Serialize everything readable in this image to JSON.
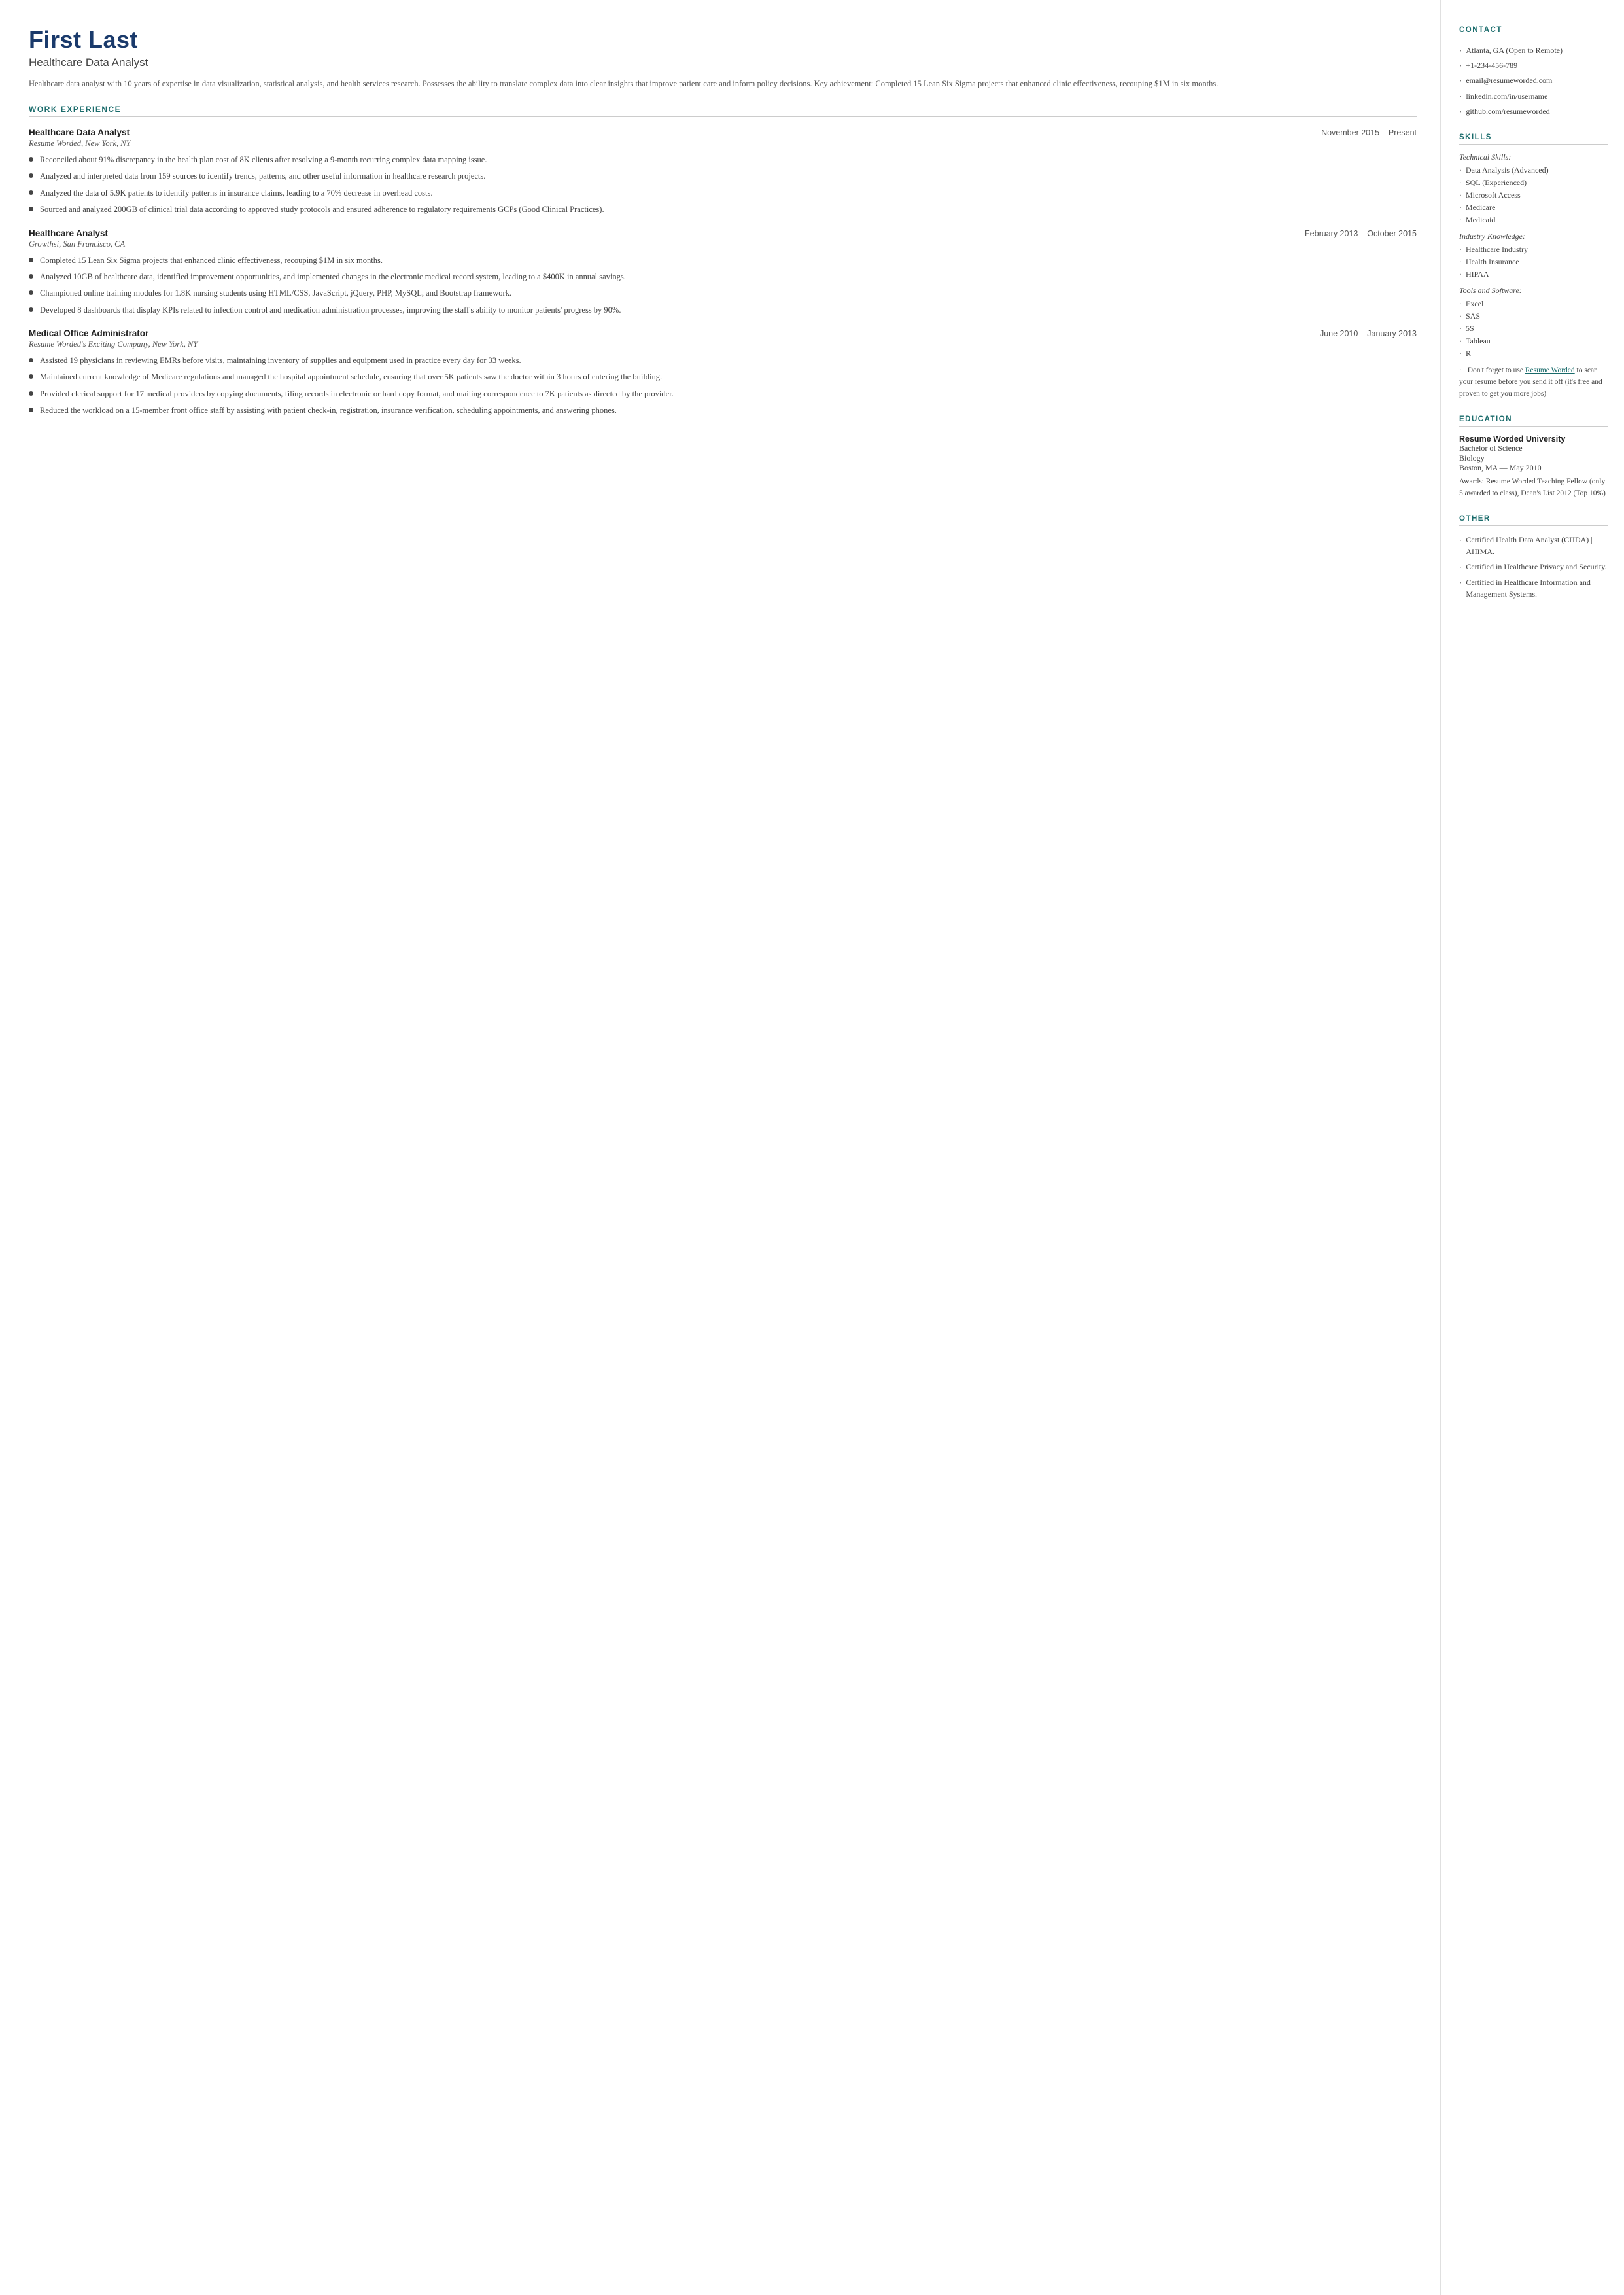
{
  "header": {
    "name": "First Last",
    "title": "Healthcare Data Analyst",
    "summary": "Healthcare data analyst with 10 years of expertise in data visualization, statistical analysis, and health services research. Possesses the ability to translate complex data into clear insights that improve patient care and inform policy decisions. Key achievement: Completed 15 Lean Six Sigma projects that enhanced clinic effectiveness, recouping $1M in six months."
  },
  "sections": {
    "work_experience_label": "WORK EXPERIENCE"
  },
  "jobs": [
    {
      "title": "Healthcare Data Analyst",
      "dates": "November 2015 – Present",
      "company": "Resume Worded, New York, NY",
      "bullets": [
        "Reconciled about 91% discrepancy in the health plan cost of 8K clients after resolving a 9-month recurring complex data mapping issue.",
        "Analyzed and interpreted data from 159 sources to identify trends, patterns, and other useful information in healthcare research projects.",
        "Analyzed the data of 5.9K patients to identify patterns in insurance claims, leading to a 70% decrease in overhead costs.",
        "Sourced and analyzed 200GB of clinical trial data according to approved study protocols and ensured adherence to regulatory requirements GCPs (Good Clinical Practices)."
      ]
    },
    {
      "title": "Healthcare Analyst",
      "dates": "February 2013 – October 2015",
      "company": "Growthsi, San Francisco, CA",
      "bullets": [
        "Completed 15 Lean Six Sigma projects that enhanced clinic effectiveness, recouping $1M in six months.",
        "Analyzed 10GB of healthcare data, identified improvement opportunities, and implemented changes in the electronic medical record system, leading to a $400K in annual savings.",
        "Championed online training modules for 1.8K nursing students using HTML/CSS, JavaScript, jQuery, PHP, MySQL, and Bootstrap framework.",
        "Developed 8 dashboards that display KPIs related to infection control and medication administration processes, improving the staff's ability to monitor patients' progress by 90%."
      ]
    },
    {
      "title": "Medical Office Administrator",
      "dates": "June 2010 – January 2013",
      "company": "Resume Worded's Exciting Company, New York, NY",
      "bullets": [
        "Assisted 19 physicians in reviewing EMRs before visits, maintaining inventory of supplies and equipment used in practice every day for 33 weeks.",
        "Maintained current knowledge of Medicare regulations and managed the hospital appointment schedule, ensuring that over 5K patients saw the doctor within 3 hours of entering the building.",
        "Provided clerical support for 17 medical providers by copying documents, filing records in electronic or hard copy format, and mailing correspondence to 7K patients as directed by the provider.",
        "Reduced the workload on a 15-member front office staff by assisting with patient check-in, registration, insurance verification, scheduling appointments, and answering phones."
      ]
    }
  ],
  "contact": {
    "label": "CONTACT",
    "items": [
      "Atlanta, GA (Open to Remote)",
      "+1-234-456-789",
      "email@resumeworded.com",
      "linkedin.com/in/username",
      "github.com/resumeworded"
    ]
  },
  "skills": {
    "label": "SKILLS",
    "technical_label": "Technical Skills:",
    "technical": [
      "Data Analysis (Advanced)",
      "SQL (Experienced)",
      "Microsoft Access",
      "Medicare",
      "Medicaid"
    ],
    "industry_label": "Industry Knowledge:",
    "industry": [
      "Healthcare Industry",
      "Health Insurance",
      "HIPAA"
    ],
    "tools_label": "Tools and Software:",
    "tools": [
      "Excel",
      "SAS",
      "5S",
      "Tableau",
      "R"
    ],
    "note_text": "Don't forget to use ",
    "note_link": "Resume Worded",
    "note_rest": " to scan your resume before you send it off (it's free and proven to get you more jobs)"
  },
  "education": {
    "label": "EDUCATION",
    "school": "Resume Worded University",
    "degree": "Bachelor of Science",
    "field": "Biology",
    "location": "Boston, MA — May 2010",
    "awards": "Awards: Resume Worded Teaching Fellow (only 5 awarded to class), Dean's List 2012 (Top 10%)"
  },
  "other": {
    "label": "OTHER",
    "items": [
      "Certified Health Data Analyst (CHDA) | AHIMA.",
      "Certified in Healthcare Privacy and Security.",
      "Certified in Healthcare Information and Management Systems."
    ]
  }
}
